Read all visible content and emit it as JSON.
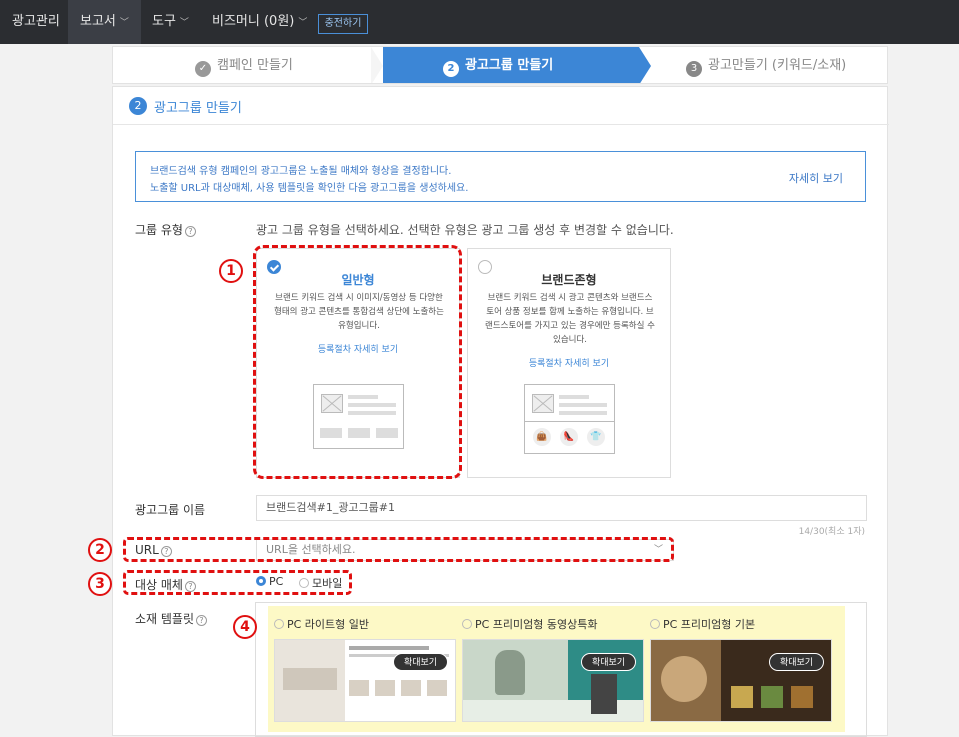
{
  "topbar": {
    "items": [
      "광고관리",
      "보고서",
      "도구",
      "비즈머니 (0원)"
    ],
    "charge_button": "충전하기"
  },
  "steps": [
    {
      "num": "✓",
      "label": "캠페인 만들기"
    },
    {
      "num": "2",
      "label": "광고그룹 만들기"
    },
    {
      "num": "3",
      "label": "광고만들기 (키워드/소재)"
    }
  ],
  "section": {
    "num": "2",
    "title": "광고그룹 만들기"
  },
  "info": {
    "line1": "브랜드검색 유형 캠페인의 광고그룹은 노출될 매체와 형상을 결정합니다.",
    "line2": "노출할 URL과 대상매체, 사용 템플릿을 확인한 다음 광고그룹을 생성하세요.",
    "more": "자세히 보기"
  },
  "group_type": {
    "label": "그룹 유형",
    "description": "광고 그룹 유형을 선택하세요. 선택한 유형은 광고 그룹 생성 후 변경할 수 없습니다.",
    "cards": [
      {
        "title": "일반형",
        "body": "브랜드 키워드 검색 시 이미지/동영상 등 다양한 형태의 광고 콘텐츠를 통합검색 상단에 노출하는 유형입니다.",
        "link": "등록절차 자세히 보기",
        "selected": true
      },
      {
        "title": "브랜드존형",
        "body": "브랜드 키워드 검색 시 광고 콘텐츠와 브랜드스토어 상품 정보를 함께 노출하는 유형입니다. 브랜드스토어를 가지고 있는 경우에만 등록하실 수 있습니다.",
        "link": "등록절차 자세히 보기",
        "selected": false
      }
    ]
  },
  "group_name": {
    "label": "광고그룹 이름",
    "value": "브랜드검색#1_광고그룹#1",
    "counter": "14/30(최소 1자)"
  },
  "url": {
    "label": "URL",
    "placeholder": "URL을 선택하세요."
  },
  "target_media": {
    "label": "대상 매체",
    "options": [
      "PC",
      "모바일"
    ],
    "selected": "PC"
  },
  "template": {
    "label": "소재 템플릿",
    "options": [
      "PC 라이트형 일반",
      "PC 프리미엄형 동영상특화",
      "PC 프리미엄형 기본"
    ],
    "expand_label": "확대보기"
  },
  "callouts": [
    "1",
    "2",
    "3",
    "4"
  ],
  "colors": {
    "accent": "#3c86d6",
    "annotation": "#e01010",
    "highlight": "#fdf9c6"
  }
}
